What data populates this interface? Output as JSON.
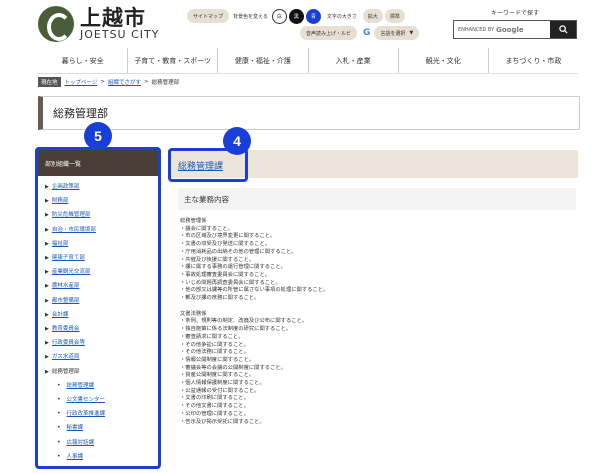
{
  "header": {
    "logo_jp": "上越市",
    "logo_en": "JOETSU CITY",
    "sitemap": "サイトマップ",
    "bg_color_label": "背景色を変える",
    "bg_white": "白",
    "bg_black": "黒",
    "bg_blue": "青",
    "font_size_label": "文字の大きさ",
    "font_larger": "拡大",
    "font_standard": "標準",
    "speech": "音声読み上げ・ルビ",
    "language": "言語を選択",
    "language_arrow": "▼",
    "google_g": "G",
    "search_label": "キーワードで探す",
    "search_placeholder_prefix": "ENHANCED BY",
    "search_placeholder_brand": "Google"
  },
  "nav": {
    "items": [
      "暮らし・安全",
      "子育て・教育・スポーツ",
      "健康・福祉・介護",
      "入札・産業",
      "観光・文化",
      "まちづくり・市政"
    ]
  },
  "breadcrumb": {
    "here": "現在地",
    "items": [
      "トップページ",
      "組織でさがす",
      "総務管理部"
    ],
    "sep": ">"
  },
  "page": {
    "title": "総務管理部"
  },
  "sidebar": {
    "heading": "部別組織一覧",
    "items": [
      "企画政策部",
      "財務部",
      "防災危機管理部",
      "自治・市民環境部",
      "福祉部",
      "健康子育て部",
      "産業観光交流部",
      "農林水産部",
      "都市整備部",
      "会計課",
      "教育委員会",
      "行政委員会等",
      "ガス水道局",
      "総務管理部"
    ],
    "sub_items": [
      "総務管理課",
      "公文書センター",
      "行政改革推進課",
      "秘書課",
      "広報対話課",
      "人事課"
    ]
  },
  "badges": {
    "sidebar": "5",
    "section": "4"
  },
  "main": {
    "section_title": "総務管理課",
    "duties_heading": "主な業務内容",
    "groups": [
      {
        "lines": [
          "総務管理係",
          "・議会に関すること。",
          "・市の区域及び境界変更に関すること。",
          "・文書の収受及び発送に関すること。",
          "・庁用消耗品の出納その他の管理に関すること。",
          "・共催及び後援に関すること。",
          "・課に属する事務の運行管理に関すること。",
          "・事故処理審査委員会に関すること。",
          "・いじめ問題再調査委員会に関すること。",
          "・他の部又は課等の所管に属さない事項の処理に関すること。",
          "・郵及び課の庶務に関すること。"
        ]
      },
      {
        "lines": [
          "文書法務係",
          "・条例、規則等の制定、改廃及び公布に関すること。",
          "・独自施策に係る法制度の研究に関すること。",
          "・審査請求に関すること。",
          "・その他争訟に関すること。",
          "・その他法務に関すること。",
          "・情報公開制度に関すること。",
          "・審議会等の会議の公開制度に関すること。",
          "・資産公開制度に関すること。",
          "・個人情報保護制度に関すること。",
          "・公益通報の受付に関すること。",
          "・文書の印刷に関すること。",
          "・その他文書に関すること。",
          "・公印の管理に関すること。",
          "・告示及び掲示受託に関すること。"
        ]
      }
    ]
  },
  "colors": {
    "accent": "#1a3fd6",
    "sidebar_head": "#4a3f36",
    "title_bar": "#6b5a4e",
    "section_bg": "#ede4da"
  }
}
